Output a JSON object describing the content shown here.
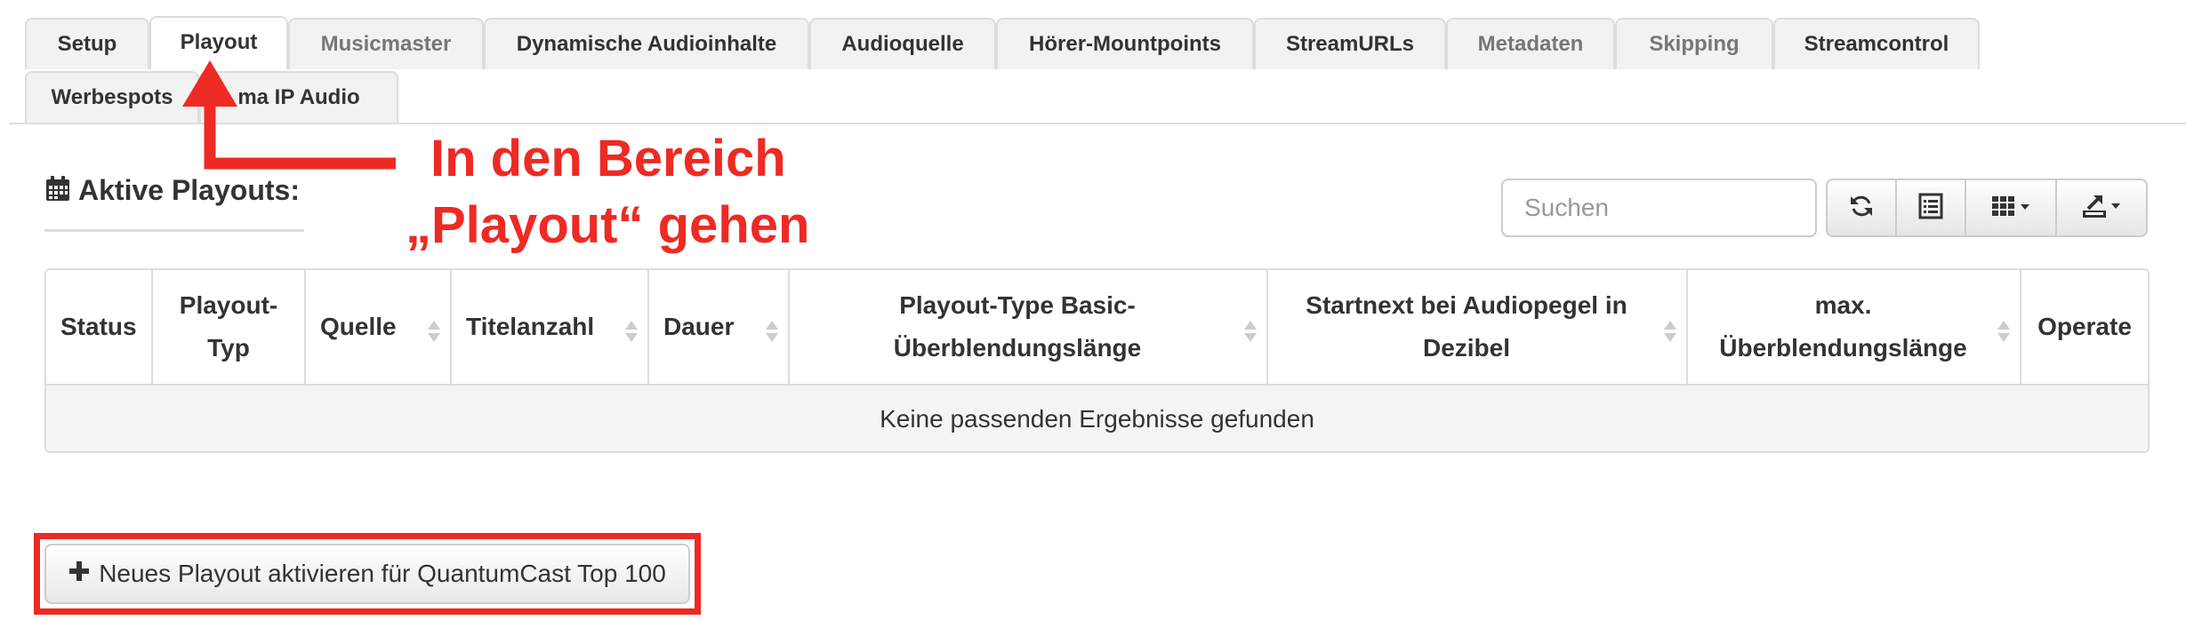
{
  "tabs": [
    {
      "label": "Setup",
      "state": "normal"
    },
    {
      "label": "Playout",
      "state": "active"
    },
    {
      "label": "Musicmaster",
      "state": "muted"
    },
    {
      "label": "Dynamische Audioinhalte",
      "state": "normal"
    },
    {
      "label": "Audioquelle",
      "state": "normal"
    },
    {
      "label": "Hörer-Mountpoints",
      "state": "normal"
    },
    {
      "label": "StreamURLs",
      "state": "normal"
    },
    {
      "label": "Metadaten",
      "state": "muted"
    },
    {
      "label": "Skipping",
      "state": "muted"
    },
    {
      "label": "Streamcontrol",
      "state": "normal"
    },
    {
      "label": "Werbespots",
      "state": "normal"
    },
    {
      "label": "ma IP Audio",
      "state": "normal"
    }
  ],
  "section": {
    "icon": "calendar-icon",
    "title": "Aktive Playouts:"
  },
  "toolbar": {
    "search_placeholder": "Suchen",
    "buttons": [
      "refresh-icon",
      "list-view-icon",
      "columns-grid-icon",
      "export-icon"
    ]
  },
  "table": {
    "columns": [
      {
        "label": "Status",
        "sortable": false
      },
      {
        "label": "Playout-Typ",
        "sortable": false
      },
      {
        "label": "Quelle",
        "sortable": true
      },
      {
        "label": "Titelanzahl",
        "sortable": true
      },
      {
        "label": "Dauer",
        "sortable": true
      },
      {
        "label": "Playout-Type Basic-Überblendungslänge",
        "sortable": true
      },
      {
        "label": "Startnext bei Audiopegel in Dezibel",
        "sortable": true
      },
      {
        "label": "max. Überblendungslänge",
        "sortable": true
      },
      {
        "label": "Operate",
        "sortable": false
      }
    ],
    "empty_message": "Keine passenden Ergebnisse gefunden"
  },
  "annotation": {
    "line1": "In den Bereich",
    "line2": "„Playout“ gehen",
    "color": "#ee2a24"
  },
  "actions": {
    "activate_label": "Neues Playout aktivieren für QuantumCast Top 100"
  }
}
